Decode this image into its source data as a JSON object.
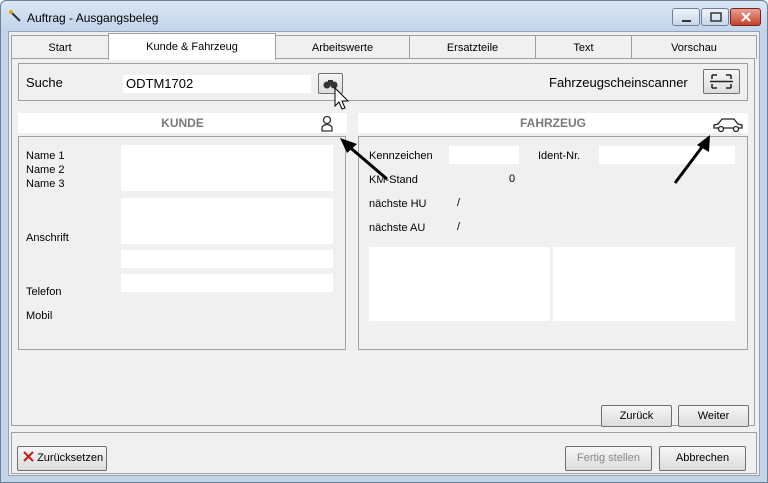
{
  "window": {
    "title": "Auftrag - Ausgangsbeleg"
  },
  "tabs": [
    {
      "label": "Start"
    },
    {
      "label": "Kunde & Fahrzeug"
    },
    {
      "label": "Arbeitswerte"
    },
    {
      "label": "Ersatzteile"
    },
    {
      "label": "Text"
    },
    {
      "label": "Vorschau"
    }
  ],
  "search": {
    "label": "Suche",
    "value": "ODTM1702",
    "scanner_label": "Fahrzeugscheinscanner"
  },
  "customer": {
    "header": "KUNDE",
    "labels": {
      "name1": "Name 1",
      "name2": "Name 2",
      "name3": "Name 3",
      "address": "Anschrift",
      "phone": "Telefon",
      "mobile": "Mobil"
    }
  },
  "vehicle": {
    "header": "FAHRZEUG",
    "labels": {
      "plate": "Kennzeichen",
      "ident": "Ident-Nr.",
      "km": "KM-Stand",
      "hu": "nächste HU",
      "au": "nächste AU"
    },
    "values": {
      "km": "0",
      "hu": "/",
      "au": "/"
    }
  },
  "nav": {
    "back": "Zurück",
    "next": "Weiter"
  },
  "footer": {
    "reset": "Zurücksetzen",
    "finish": "Fertig stellen",
    "cancel": "Abbrechen"
  }
}
